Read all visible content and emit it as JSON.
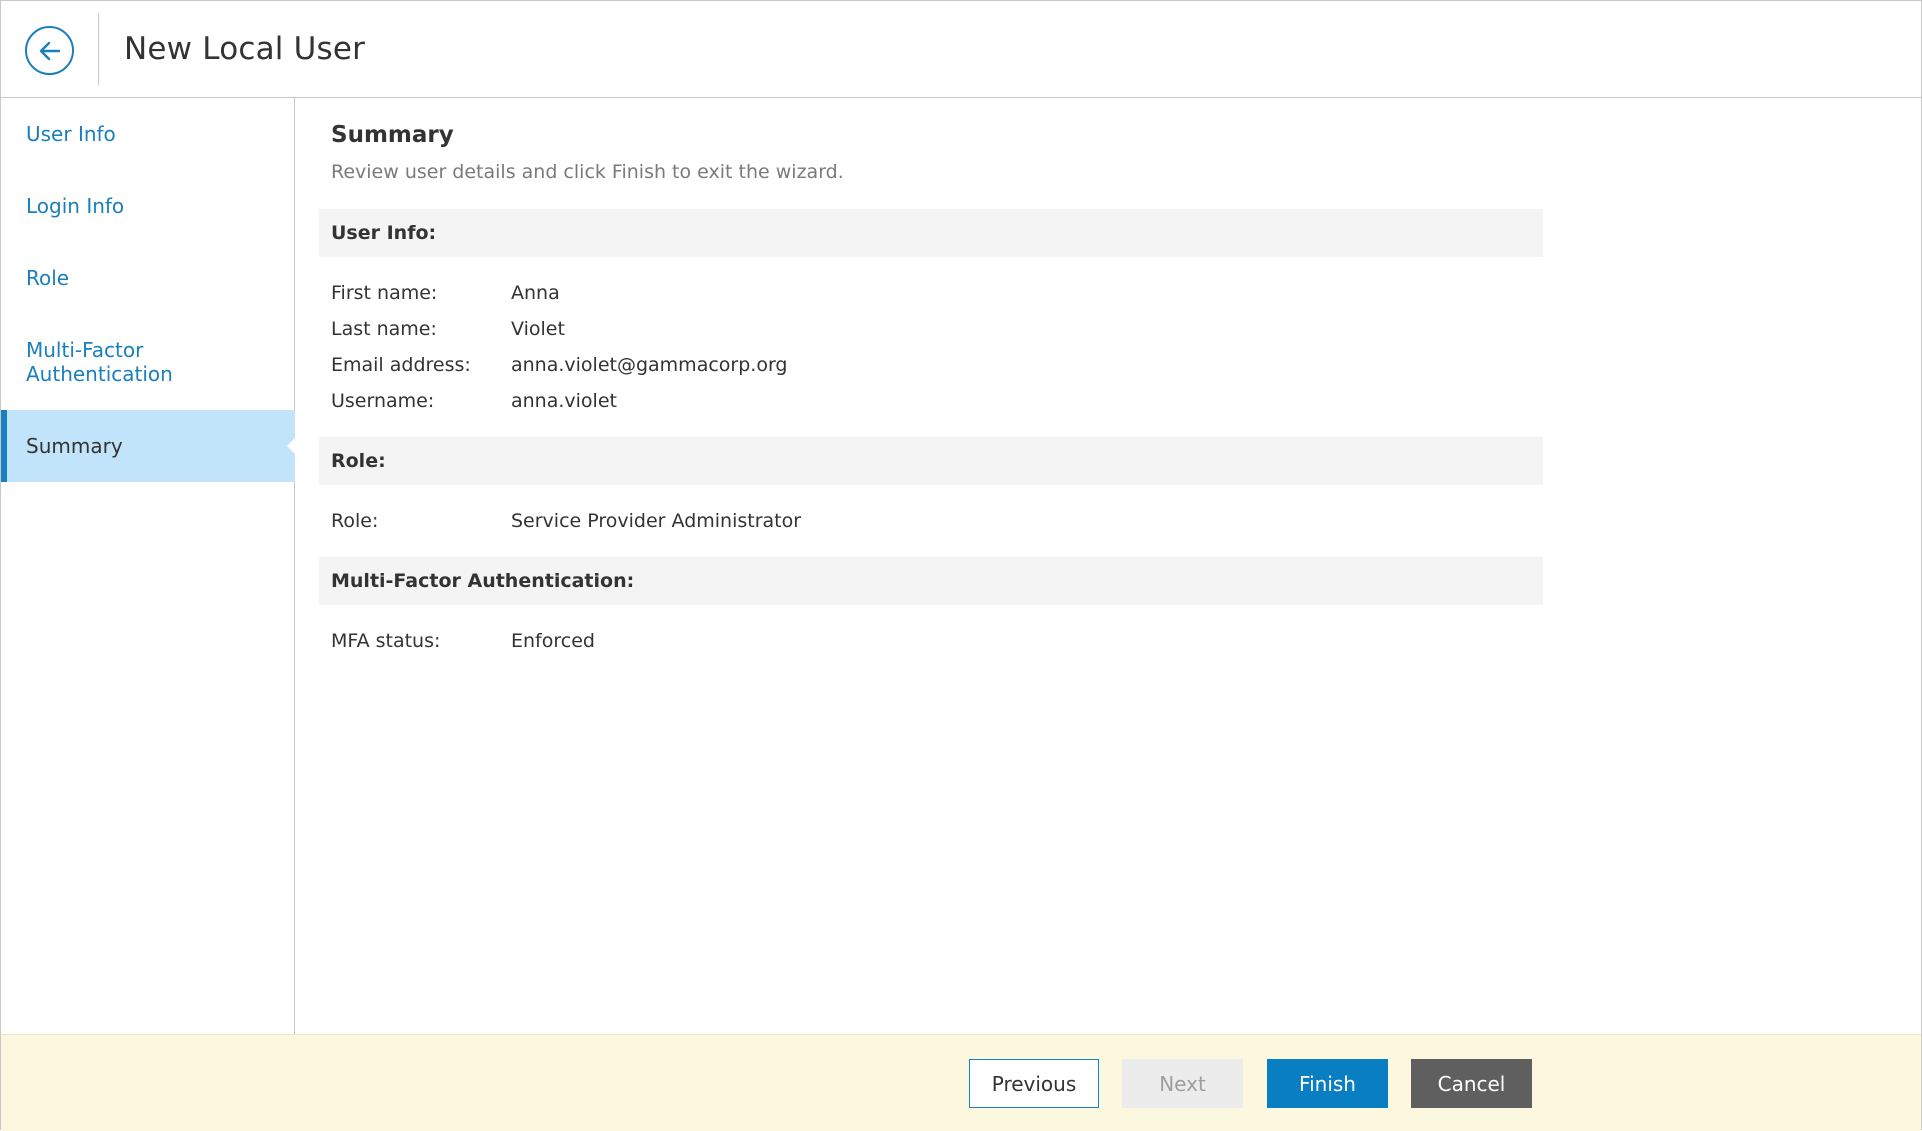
{
  "header": {
    "title": "New Local User",
    "back_icon": "arrow-left-icon"
  },
  "sidebar": {
    "items": [
      {
        "label": "User Info",
        "active": false
      },
      {
        "label": "Login Info",
        "active": false
      },
      {
        "label": "Role",
        "active": false
      },
      {
        "label": "Multi-Factor Authentication",
        "active": false
      },
      {
        "label": "Summary",
        "active": true
      }
    ]
  },
  "main": {
    "title": "Summary",
    "description": "Review user details and click Finish to exit the wizard.",
    "sections": [
      {
        "heading": "User Info:",
        "rows": [
          {
            "label": "First name:",
            "value": "Anna"
          },
          {
            "label": "Last name:",
            "value": "Violet"
          },
          {
            "label": "Email address:",
            "value": "anna.violet@gammacorp.org"
          },
          {
            "label": "Username:",
            "value": "anna.violet"
          }
        ]
      },
      {
        "heading": "Role:",
        "rows": [
          {
            "label": "Role:",
            "value": "Service Provider Administrator"
          }
        ]
      },
      {
        "heading": "Multi-Factor Authentication:",
        "rows": [
          {
            "label": "MFA status:",
            "value": "Enforced"
          }
        ]
      }
    ]
  },
  "footer": {
    "previous_label": "Previous",
    "next_label": "Next",
    "finish_label": "Finish",
    "cancel_label": "Cancel"
  },
  "colors": {
    "accent": "#1a7fbd",
    "active_nav_bg": "#c2e4fa",
    "footer_bg": "#fcf8df",
    "finish_bg": "#0a7ec2",
    "cancel_bg": "#5f5f5f"
  }
}
